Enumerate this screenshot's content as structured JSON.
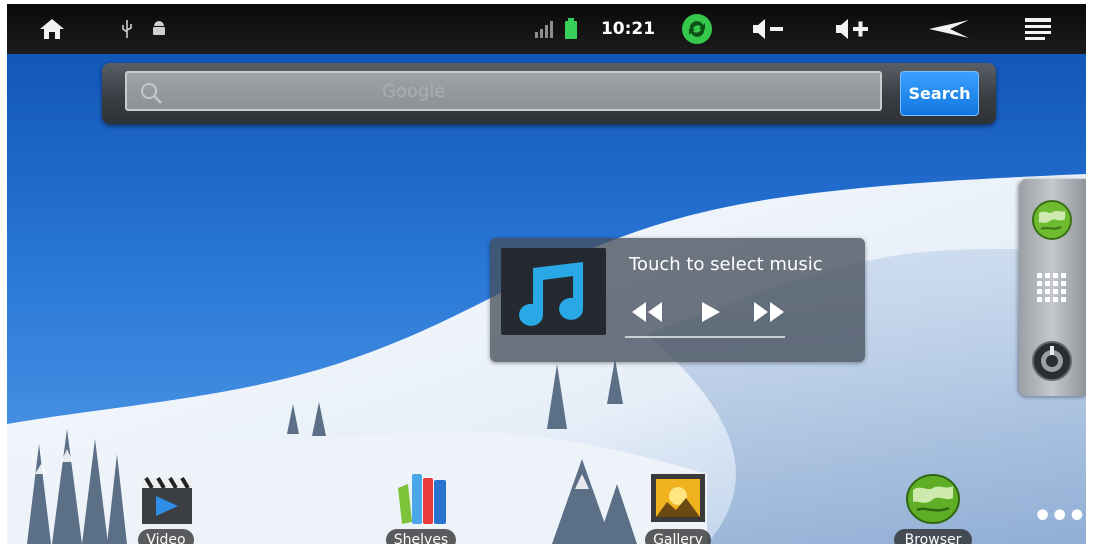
{
  "status_bar": {
    "icons": [
      "home-icon",
      "usb-icon",
      "android-debug-icon",
      "signal-icon",
      "battery-icon",
      "sync-icon",
      "volume-down-icon",
      "volume-up-icon",
      "back-icon",
      "menu-icon"
    ],
    "time": "10:21",
    "colors": {
      "background": "#111111",
      "battery": "#38d05a",
      "sync": "#35c84a"
    }
  },
  "search": {
    "placeholder": "Google",
    "button_label": "Search",
    "colors": {
      "button": "#1a86f0"
    }
  },
  "music_widget": {
    "title": "Touch to select music",
    "icons": [
      "music-note-icon",
      "rewind-icon",
      "play-icon",
      "fast-forward-icon"
    ]
  },
  "side_panel": {
    "icons": [
      "browser-globe-icon",
      "app-grid-icon",
      "settings-icon"
    ]
  },
  "dock": {
    "apps": [
      {
        "label": "Video",
        "icon": "video-clapper-icon"
      },
      {
        "label": "Shelves",
        "icon": "books-icon"
      },
      {
        "label": "Gallery",
        "icon": "gallery-picture-icon"
      },
      {
        "label": "Browser",
        "icon": "browser-globe-icon"
      }
    ],
    "more": "•••"
  }
}
